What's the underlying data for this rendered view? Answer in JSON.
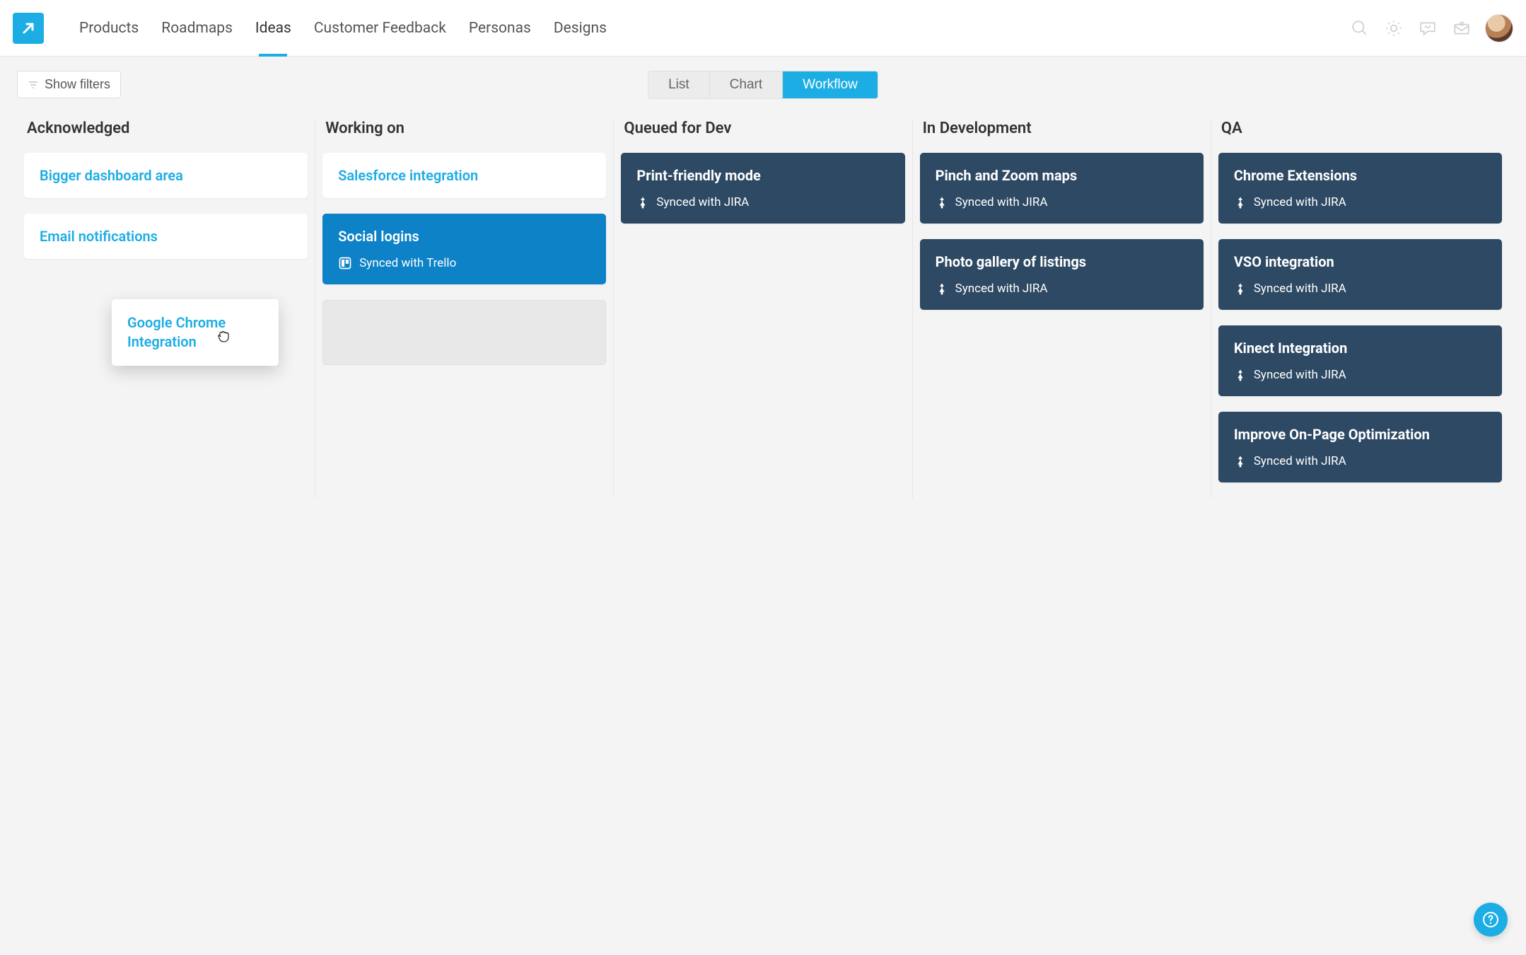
{
  "nav": {
    "items": [
      {
        "label": "Products",
        "active": false
      },
      {
        "label": "Roadmaps",
        "active": false
      },
      {
        "label": "Ideas",
        "active": true
      },
      {
        "label": "Customer Feedback",
        "active": false
      },
      {
        "label": "Personas",
        "active": false
      },
      {
        "label": "Designs",
        "active": false
      }
    ]
  },
  "toolbar": {
    "filters_label": "Show filters",
    "view_tabs": [
      {
        "label": "List",
        "active": false
      },
      {
        "label": "Chart",
        "active": false
      },
      {
        "label": "Workflow",
        "active": true
      }
    ]
  },
  "columns": [
    {
      "title": "Acknowledged",
      "cards": [
        {
          "title": "Bigger dashboard area",
          "variant": "white"
        },
        {
          "title": "Email notifications",
          "variant": "white"
        }
      ]
    },
    {
      "title": "Working on",
      "cards": [
        {
          "title": "Salesforce integration",
          "variant": "white"
        },
        {
          "title": "Social logins",
          "variant": "blue",
          "sync_label": "Synced with Trello",
          "sync_icon": "trello"
        },
        {
          "variant": "placeholder"
        }
      ]
    },
    {
      "title": "Queued for Dev",
      "cards": [
        {
          "title": "Print-friendly mode",
          "variant": "dark",
          "sync_label": "Synced with JIRA",
          "sync_icon": "jira"
        }
      ]
    },
    {
      "title": "In Development",
      "cards": [
        {
          "title": "Pinch and Zoom maps",
          "variant": "dark",
          "sync_label": "Synced with JIRA",
          "sync_icon": "jira"
        },
        {
          "title": "Photo gallery of listings",
          "variant": "dark",
          "sync_label": "Synced with JIRA",
          "sync_icon": "jira"
        }
      ]
    },
    {
      "title": "QA",
      "cards": [
        {
          "title": "Chrome Extensions",
          "variant": "dark",
          "sync_label": "Synced with JIRA",
          "sync_icon": "jira"
        },
        {
          "title": "VSO integration",
          "variant": "dark",
          "sync_label": "Synced with JIRA",
          "sync_icon": "jira"
        },
        {
          "title": "Kinect Integration",
          "variant": "dark",
          "sync_label": "Synced with JIRA",
          "sync_icon": "jira"
        },
        {
          "title": "Improve On-Page Optimization",
          "variant": "dark",
          "sync_label": "Synced with JIRA",
          "sync_icon": "jira"
        }
      ]
    }
  ],
  "dragging_card": {
    "title": "Google Chrome Integration"
  },
  "help_label": "?"
}
